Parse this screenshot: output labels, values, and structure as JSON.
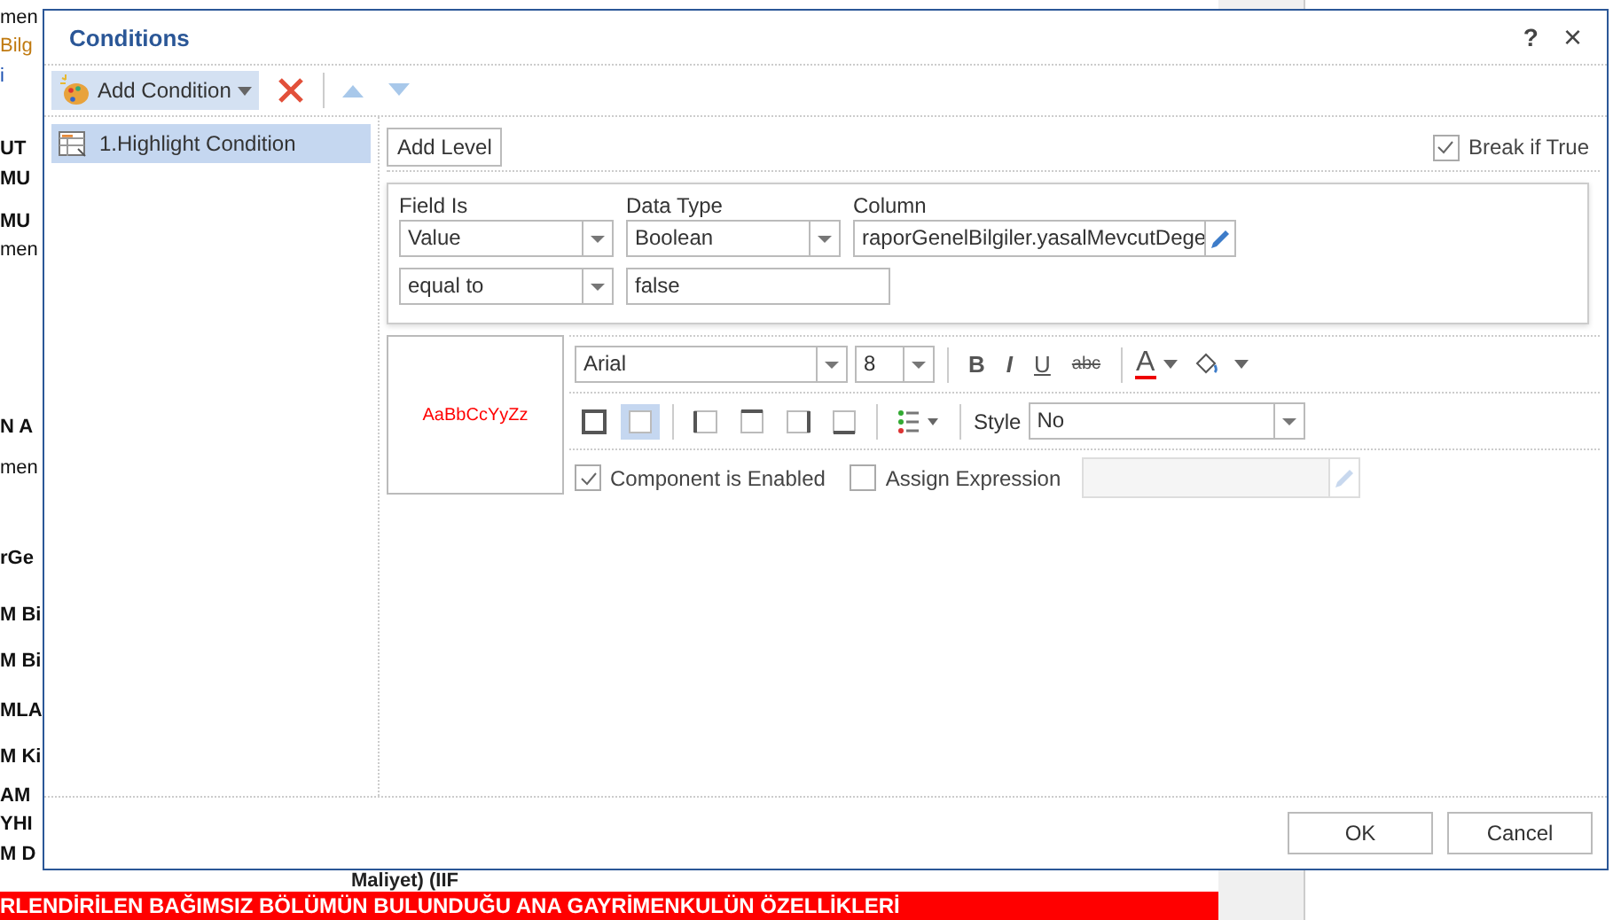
{
  "background": {
    "fragments": [
      {
        "text": "men",
        "kind": "plain"
      },
      {
        "text": "Bilg",
        "kind": "field"
      },
      {
        "text": "i",
        "kind": "link"
      },
      {
        "text": "UT",
        "kind": "bold"
      },
      {
        "text": "MU",
        "kind": "bold"
      },
      {
        "text": "MU",
        "kind": "bold"
      },
      {
        "text": "men",
        "kind": "plain"
      },
      {
        "text": "N A",
        "kind": "bold"
      },
      {
        "text": "men",
        "kind": "plain"
      },
      {
        "text": "rGe",
        "kind": "bold"
      },
      {
        "text": "M Bi",
        "kind": "bold"
      },
      {
        "text": "M Bi",
        "kind": "bold"
      },
      {
        "text": "MLA",
        "kind": "bold"
      },
      {
        "text": "M Ki",
        "kind": "bold"
      },
      {
        "text": "AM",
        "kind": "bold"
      },
      {
        "text": "YHI",
        "kind": "bold"
      },
      {
        "text": "M D",
        "kind": "bold"
      }
    ],
    "caption": "Maliyet) (IIF",
    "banner": "RLENDİRİLEN BAĞIMSIZ BÖLÜMÜN BULUNDUĞU ANA GAYRİMENKULÜN ÖZELLİKLERİ"
  },
  "window": {
    "title": "Conditions",
    "help": "?",
    "close": "×"
  },
  "toolbar": {
    "add": "Add Condition"
  },
  "conditions": [
    {
      "label": "1.Highlight Condition",
      "selected": true
    }
  ],
  "add_level": "Add Level",
  "break_if_true": {
    "label": "Break if True",
    "checked": true
  },
  "filter": {
    "field_is_label": "Field Is",
    "field_is": "Value",
    "data_type_label": "Data Type",
    "data_type": "Boolean",
    "column_label": "Column",
    "column": "raporGenelBilgiler.yasalMevcutDege",
    "operator": "equal to",
    "value": "false"
  },
  "format": {
    "preview": "AaBbCcYyZz",
    "font": "Arial",
    "size": "8",
    "bold": "B",
    "italic": "I",
    "underline": "U",
    "strike": "abc",
    "font_color": "A",
    "style_label": "Style",
    "style": "No",
    "border_buttons": [
      {
        "kind": "all",
        "selected": false
      },
      {
        "kind": "none",
        "selected": true
      },
      {
        "kind": "left",
        "selected": false
      },
      {
        "kind": "top",
        "selected": false
      },
      {
        "kind": "right",
        "selected": false
      },
      {
        "kind": "bottom",
        "selected": false
      }
    ],
    "component_enabled": {
      "label": "Component is Enabled",
      "checked": true
    },
    "assign_expression": {
      "label": "Assign Expression",
      "checked": false
    }
  },
  "buttons": {
    "ok": "OK",
    "cancel": "Cancel"
  }
}
